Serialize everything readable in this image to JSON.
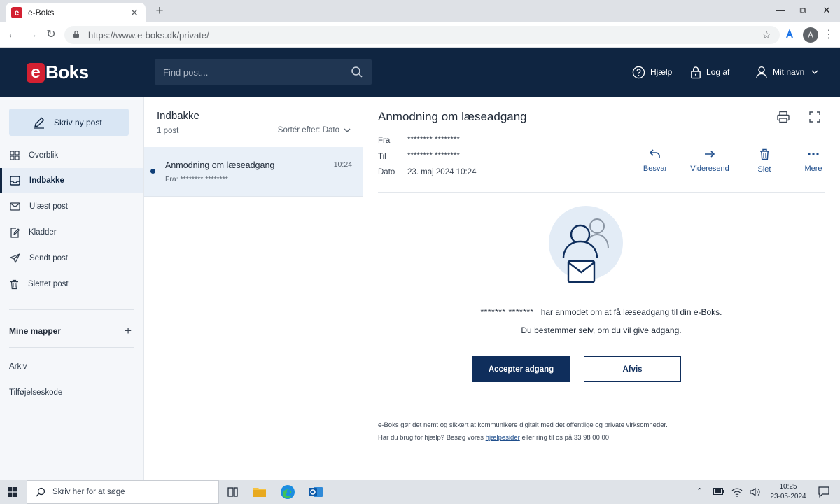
{
  "browser": {
    "tab_title": "e-Boks",
    "url": "https://www.e-boks.dk/private/",
    "profile_initial": "A"
  },
  "header": {
    "logo_e": "e",
    "logo_text": "Boks",
    "search_placeholder": "Find post...",
    "help_label": "Hjælp",
    "logout_label": "Log af",
    "user_label": "Mit navn"
  },
  "sidebar": {
    "compose_label": "Skriv ny post",
    "items": [
      {
        "label": "Overblik",
        "icon": "grid-icon"
      },
      {
        "label": "Indbakke",
        "icon": "inbox-icon",
        "active": true
      },
      {
        "label": "Ulæst post",
        "icon": "envelope-icon"
      },
      {
        "label": "Kladder",
        "icon": "draft-icon"
      },
      {
        "label": "Sendt post",
        "icon": "send-icon"
      },
      {
        "label": "Slettet post",
        "icon": "trash-icon"
      }
    ],
    "folders_title": "Mine mapper",
    "folders": [
      "Arkiv",
      "Tilføjelseskode"
    ]
  },
  "list": {
    "title": "Indbakke",
    "count": "1 post",
    "sort_label": "Sortér efter: Dato",
    "messages": [
      {
        "subject": "Anmodning om læseadgang",
        "from": "Fra: ******** ********",
        "time": "10:24",
        "unread": true
      }
    ]
  },
  "reader": {
    "title": "Anmodning om læseadgang",
    "meta": {
      "from_label": "Fra",
      "from_value": "******** ********",
      "to_label": "Til",
      "to_value": "******** ********",
      "date_label": "Dato",
      "date_value": "23. maj 2024 10:24"
    },
    "actions": [
      {
        "label": "Besvar",
        "icon": "reply-icon"
      },
      {
        "label": "Videresend",
        "icon": "forward-icon"
      },
      {
        "label": "Slet",
        "icon": "trash-icon"
      },
      {
        "label": "Mere",
        "icon": "more-icon"
      }
    ],
    "request_masked": "******* *******",
    "request_text": "har anmodet om at få læseadgang til din e-Boks.",
    "request_sub": "Du bestemmer selv, om du vil give adgang.",
    "accept_label": "Accepter adgang",
    "reject_label": "Afvis",
    "footer_line1": "e-Boks gør det nemt og sikkert at kommunikere digitalt med det offentlige og private virksomheder.",
    "footer_line2_pre": "Har du brug for hjælp? Besøg vores",
    "footer_link": "hjælpesider",
    "footer_line2_post": "eller ring til os på 33 98 00 00."
  },
  "taskbar": {
    "search_placeholder": "Skriv her for at søge",
    "time": "10:25",
    "date": "23-05-2024"
  },
  "colors": {
    "brand_navy": "#0f2541",
    "brand_red": "#d32031",
    "accent_blue": "#1f4e8c"
  }
}
